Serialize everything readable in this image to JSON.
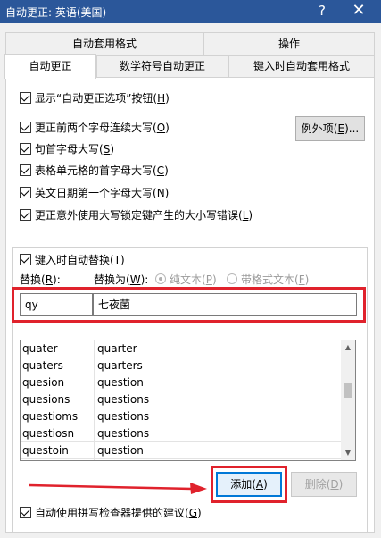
{
  "window": {
    "title": "自动更正: 英语(美国)",
    "help_glyph": "?",
    "close_glyph": "✕"
  },
  "tabs_row1": [
    {
      "label": "自动套用格式"
    },
    {
      "label": "操作"
    }
  ],
  "tabs_row2": [
    {
      "label": "自动更正",
      "active": true
    },
    {
      "label": "数学符号自动更正"
    },
    {
      "label": "键入时自动套用格式"
    }
  ],
  "options": [
    {
      "pre": "显示“自动更正选项”按钮(",
      "key": "H",
      "post": ")",
      "checked": true
    },
    {
      "pre": "更正前两个字母连续大写(",
      "key": "O",
      "post": ")",
      "checked": true
    },
    {
      "pre": "句首字母大写(",
      "key": "S",
      "post": ")",
      "checked": true
    },
    {
      "pre": "表格单元格的首字母大写(",
      "key": "C",
      "post": ")",
      "checked": true
    },
    {
      "pre": "英文日期第一个字母大写(",
      "key": "N",
      "post": ")",
      "checked": true
    },
    {
      "pre": "更正意外使用大写锁定键产生的大小写错误(",
      "key": "L",
      "post": ")",
      "checked": true
    }
  ],
  "exceptions_button": {
    "pre": "例外项(",
    "key": "E",
    "post": ")..."
  },
  "replace_section": {
    "toggle": {
      "pre": "键入时自动替换(",
      "key": "T",
      "post": ")",
      "checked": true
    },
    "replace_label": {
      "pre": "替换(",
      "key": "R",
      "post": "):"
    },
    "with_label": {
      "pre": "替换为(",
      "key": "W",
      "post": "):"
    },
    "plain_text": {
      "pre": "纯文本(",
      "key": "P",
      "post": ")",
      "selected": true
    },
    "formatted_text": {
      "pre": "带格式文本(",
      "key": "F",
      "post": ")",
      "selected": false
    },
    "replace_value": "qy",
    "with_value": "七夜菌"
  },
  "entries": [
    {
      "from": "quater",
      "to": "quarter"
    },
    {
      "from": "quaters",
      "to": "quarters"
    },
    {
      "from": "quesion",
      "to": "question"
    },
    {
      "from": "quesions",
      "to": "questions"
    },
    {
      "from": "questioms",
      "to": "questions"
    },
    {
      "from": "questiosn",
      "to": "questions"
    },
    {
      "from": "questoin",
      "to": "question"
    }
  ],
  "add_button": {
    "pre": "添加(",
    "key": "A",
    "post": ")"
  },
  "delete_button": {
    "pre": "删除(",
    "key": "D",
    "post": ")"
  },
  "spell_option": {
    "pre": "自动使用拼写检查器提供的建议(",
    "key": "G",
    "post": ")",
    "checked": true
  },
  "colors": {
    "titlebar": "#2b579a",
    "highlight": "#e0222c"
  }
}
